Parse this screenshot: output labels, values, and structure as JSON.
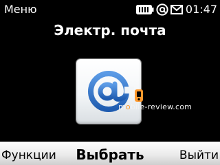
{
  "status_bar": {
    "menu_label": "Меню",
    "time": "01:47",
    "icons": [
      "battery-icon",
      "at-icon",
      "mail-icon"
    ]
  },
  "screen": {
    "title": "Электр. почта",
    "app_icon": "email-at-icon"
  },
  "watermark": {
    "prefix": "m",
    "accent": "o",
    "suffix": "bile-review.com"
  },
  "softkeys": {
    "left": "Функции",
    "center": "Выбрать",
    "right": "Выйти"
  },
  "colors": {
    "background": "#000000",
    "icon_blue": "#2f6fc3",
    "softkey_bar": "#ececec",
    "watermark_accent": "#ff9a2e"
  }
}
